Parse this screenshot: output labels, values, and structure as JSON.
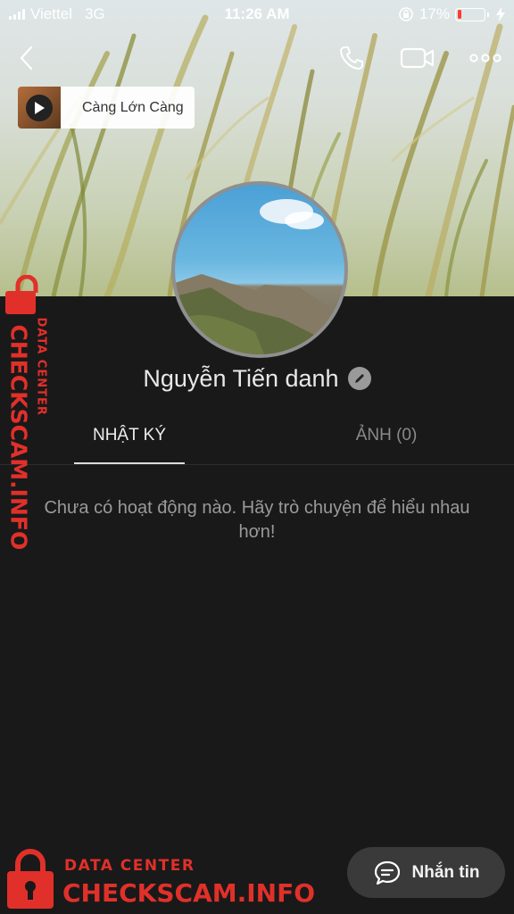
{
  "status_bar": {
    "carrier": "Viettel",
    "network": "3G",
    "time": "11:26 AM",
    "battery_percent": "17%",
    "battery_level": 0.17
  },
  "music": {
    "title": "Càng Lớn Càng"
  },
  "profile": {
    "name": "Nguyễn Tiến danh"
  },
  "tabs": [
    {
      "label": "NHẬT KÝ",
      "active": true
    },
    {
      "label": "ẢNH (0)",
      "active": false
    }
  ],
  "empty_state": {
    "message": "Chưa có hoạt động nào. Hãy trò chuyện để hiểu nhau hơn!"
  },
  "actions": {
    "message_button": "Nhắn tin"
  },
  "watermark": {
    "small": "DATA CENTER",
    "large": "CHECKSCAM.INFO"
  },
  "icons": {
    "back": "chevron-left-icon",
    "call": "phone-icon",
    "video": "video-camera-icon",
    "more": "more-horizontal-icon",
    "play": "play-icon",
    "edit": "pencil-icon",
    "chat": "chat-bubble-icon",
    "lock": "padlock-icon"
  },
  "colors": {
    "background": "#191919",
    "watermark_red": "#e1302a",
    "battery_low": "#ff3b30"
  }
}
